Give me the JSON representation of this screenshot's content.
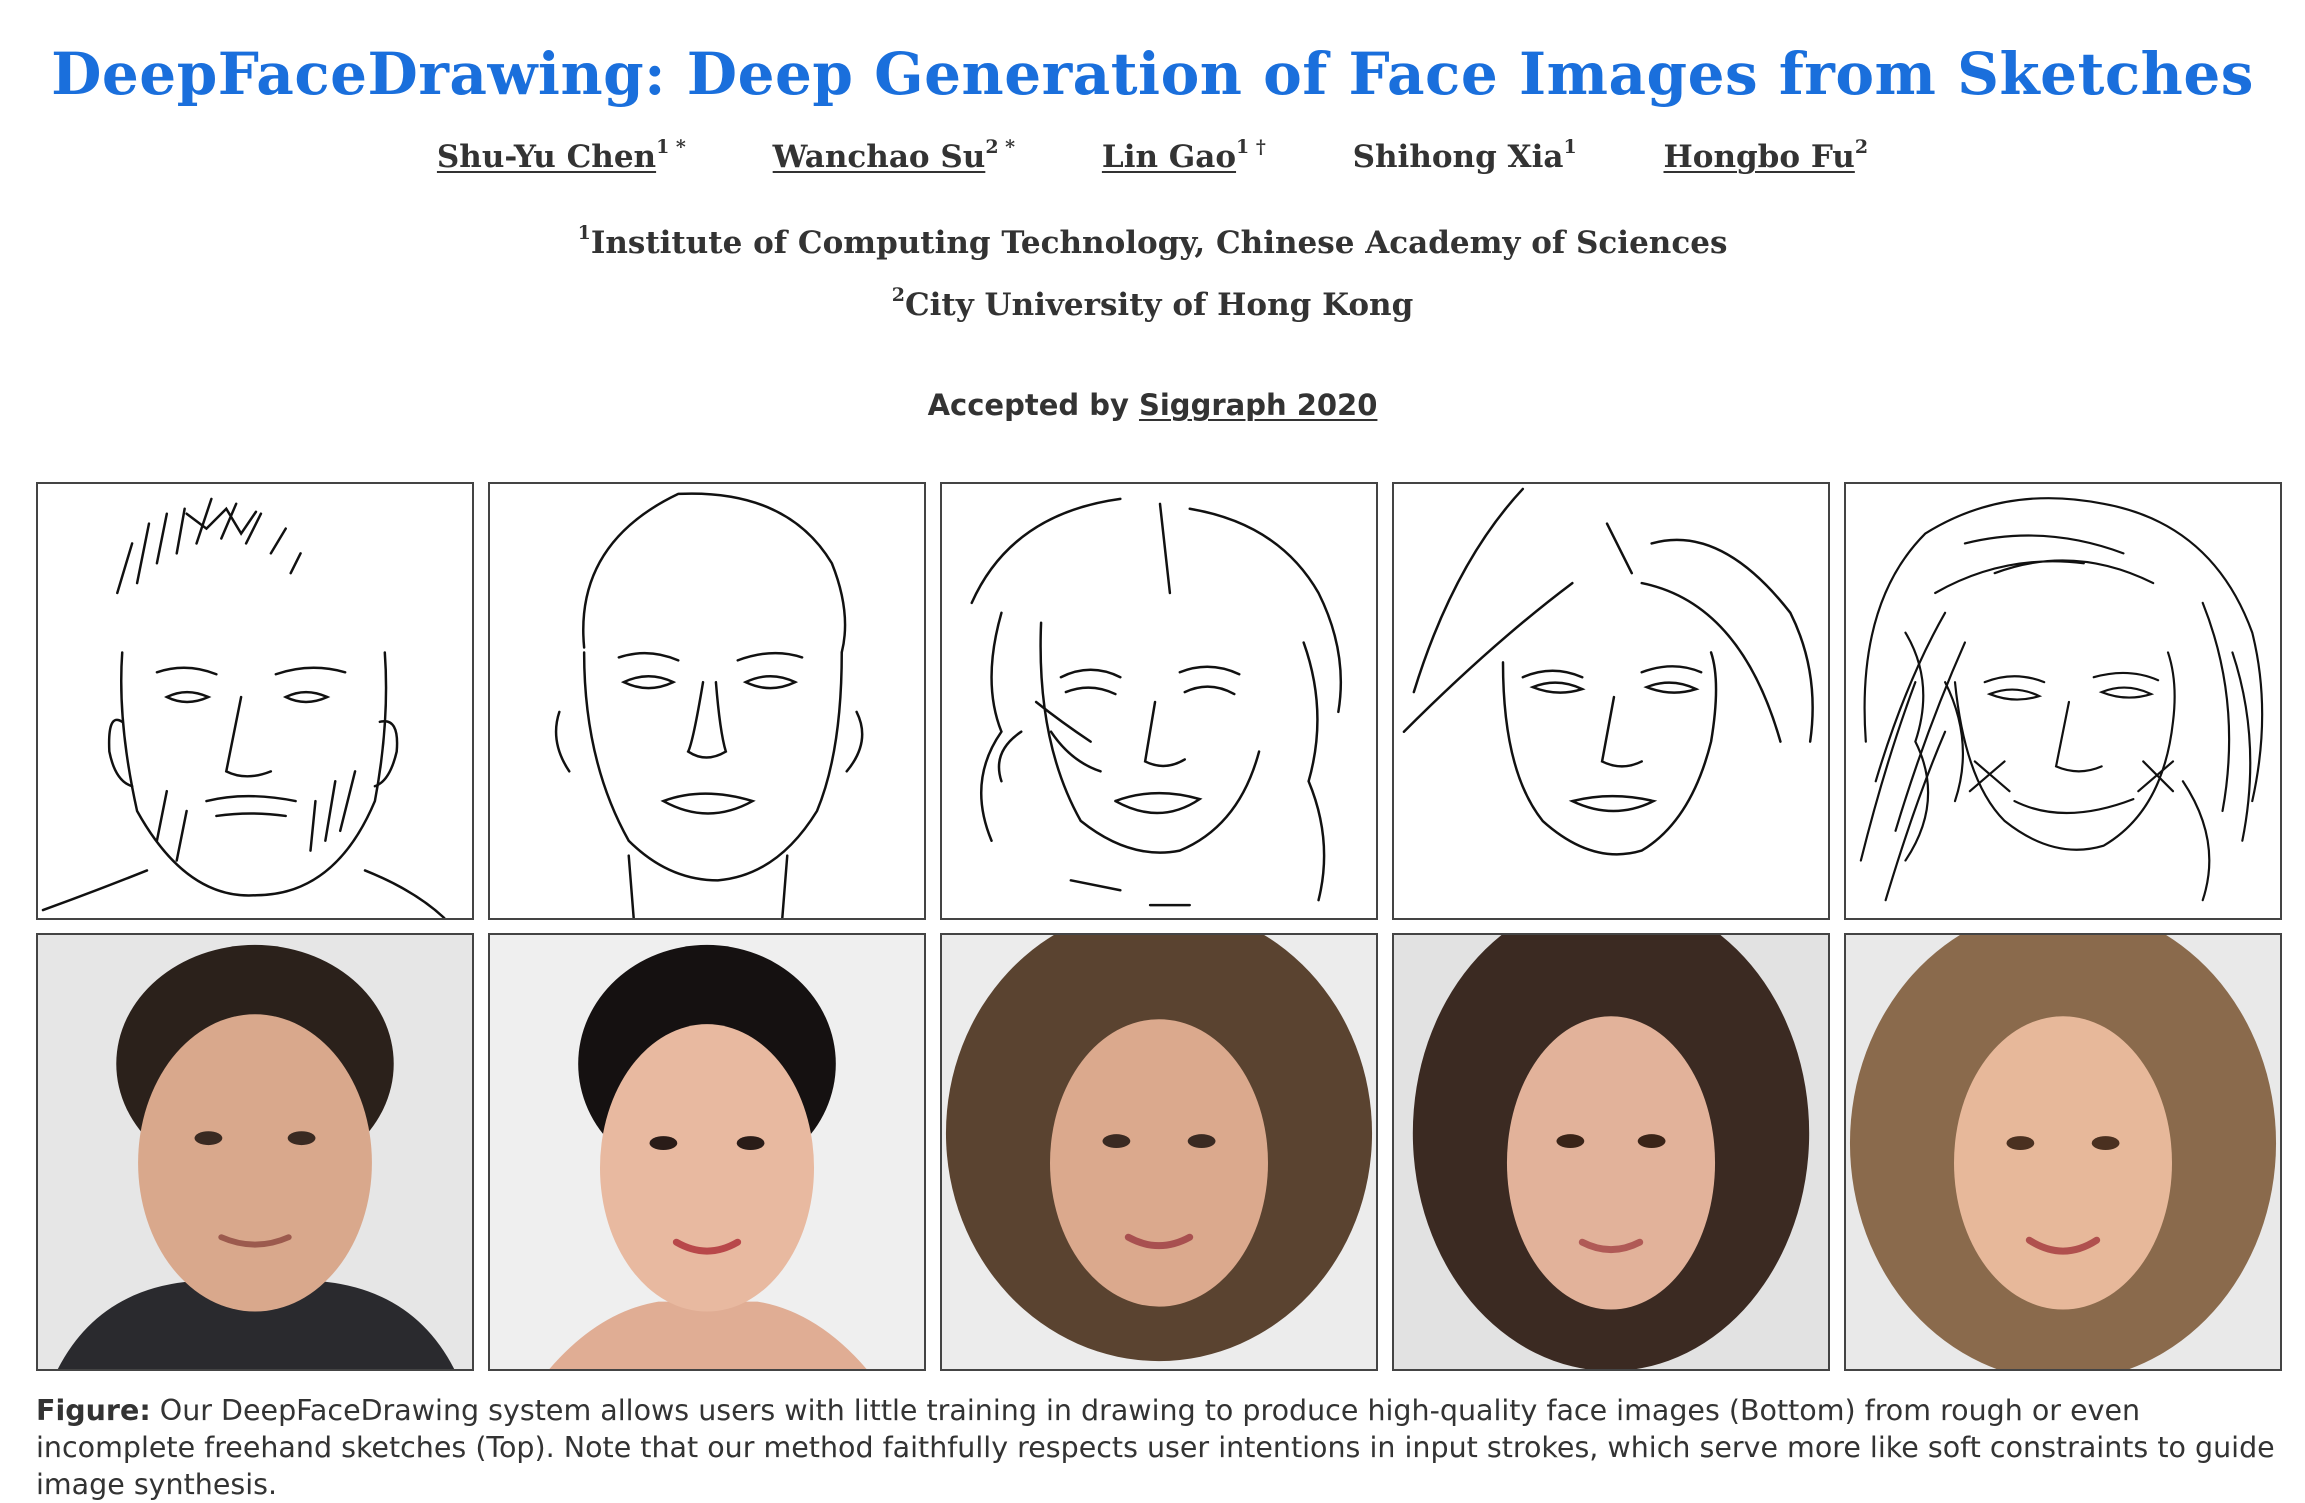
{
  "colors": {
    "title": "#1a6fdc",
    "text": "#333333",
    "border": "#444444"
  },
  "title": "DeepFaceDrawing: Deep Generation of Face Images from Sketches",
  "authors": [
    {
      "name": "Shu-Yu Chen",
      "sup": "1 *",
      "linked": true
    },
    {
      "name": "Wanchao Su",
      "sup": "2 *",
      "linked": true
    },
    {
      "name": "Lin Gao",
      "sup": "1 †",
      "linked": true
    },
    {
      "name": "Shihong Xia",
      "sup": "1",
      "linked": false
    },
    {
      "name": "Hongbo Fu",
      "sup": "2",
      "linked": true
    }
  ],
  "affiliations": [
    {
      "sup": "1",
      "text": "Institute of Computing Technology, Chinese Academy of Sciences"
    },
    {
      "sup": "2",
      "text": "City University of Hong Kong"
    }
  ],
  "accepted": {
    "prefix": "Accepted by ",
    "venue": "Siggraph 2020"
  },
  "figure": {
    "sketches": [
      {
        "label": "sketch-1"
      },
      {
        "label": "sketch-2"
      },
      {
        "label": "sketch-3"
      },
      {
        "label": "sketch-4"
      },
      {
        "label": "sketch-5"
      }
    ],
    "photos": [
      {
        "skin": "#d9a88c",
        "hair": "#2b211b",
        "bg": "#e6e6e6"
      },
      {
        "skin": "#e8b9a0",
        "hair": "#151111",
        "bg": "#efefef"
      },
      {
        "skin": "#dba98d",
        "hair": "#5a4330",
        "bg": "#ececec"
      },
      {
        "skin": "#e2b29a",
        "hair": "#3b2a22",
        "bg": "#e2e2e2"
      },
      {
        "skin": "#e7b89a",
        "hair": "#8a6a4c",
        "bg": "#e9e9e9"
      }
    ]
  },
  "caption": {
    "label": "Figure:",
    "text": " Our DeepFaceDrawing system allows users with little training in drawing to produce high-quality face images (Bottom) from rough or even incomplete freehand sketches (Top). Note that our method faithfully respects user intentions in input strokes, which serve more like soft constraints to guide image synthesis."
  }
}
